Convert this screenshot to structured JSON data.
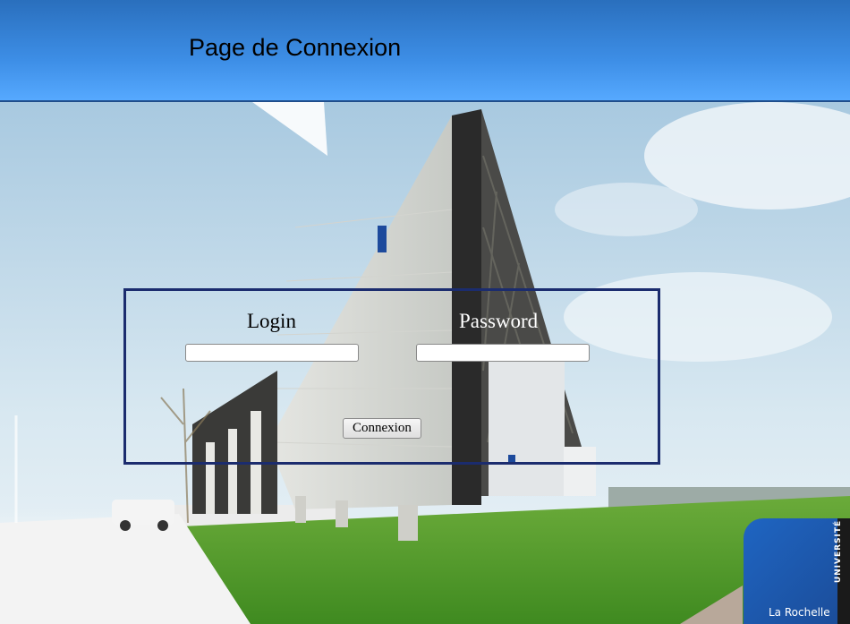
{
  "header": {
    "title": "Page de Connexion"
  },
  "login_form": {
    "login_label": "Login",
    "password_label": "Password",
    "login_value": "",
    "password_value": "",
    "submit_label": "Connexion"
  },
  "logo": {
    "vertical_text": "UNIVERSITÉ",
    "city_text": "La Rochelle"
  },
  "colors": {
    "header_blue": "#3d8ee6",
    "form_border": "#1b2c6e",
    "logo_blue": "#1f65c2"
  }
}
